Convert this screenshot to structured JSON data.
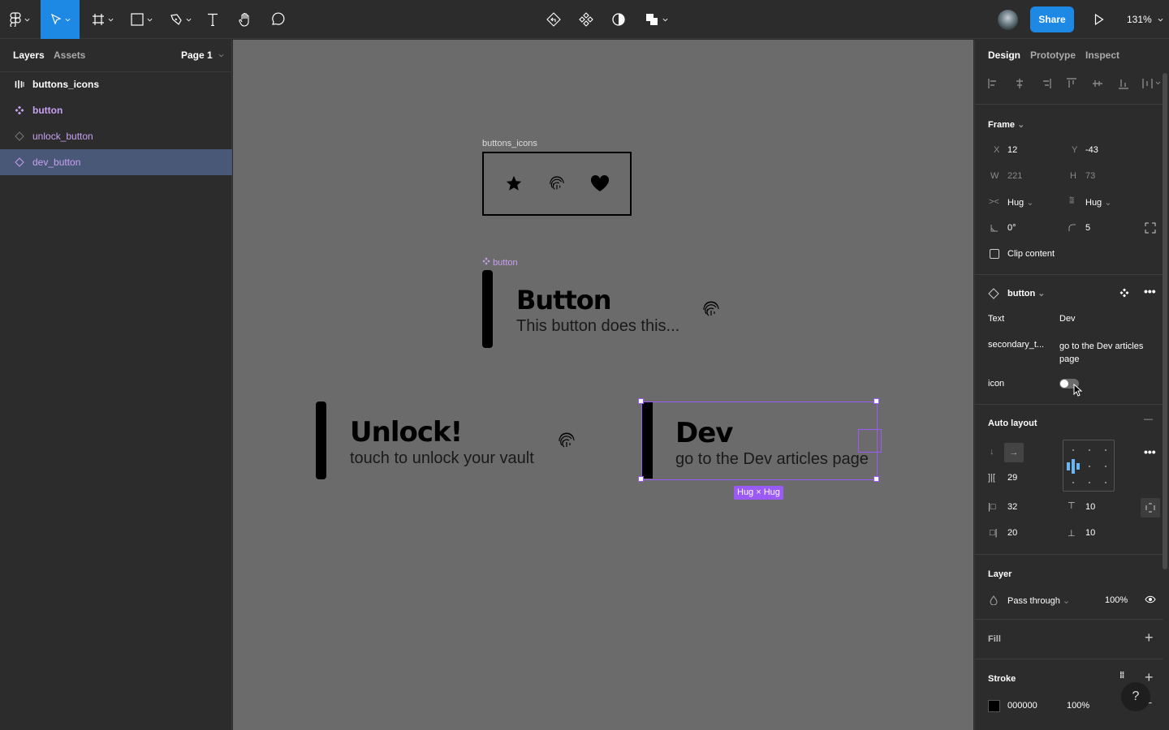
{
  "toolbar": {
    "zoom": "131%",
    "share_label": "Share",
    "tools": [
      "main-menu",
      "move",
      "frame",
      "shape",
      "pen",
      "text",
      "hand",
      "comment"
    ],
    "center_tools": [
      "back-to-instance",
      "components",
      "theme",
      "boolean"
    ]
  },
  "left_panel": {
    "tabs": [
      "Layers",
      "Assets"
    ],
    "page": "Page 1",
    "layers": [
      {
        "name": "buttons_icons",
        "icon": "auto-layout-icon",
        "color": "#ffffff"
      },
      {
        "name": "button",
        "icon": "component-icon",
        "color": "#c7a0f0"
      },
      {
        "name": "unlock_button",
        "icon": "instance-icon",
        "color": "#c7a0f0"
      },
      {
        "name": "dev_button",
        "icon": "instance-icon",
        "color": "#c7a0f0",
        "selected": true
      }
    ]
  },
  "canvas": {
    "icons_frame_label": "buttons_icons",
    "component_label": "button",
    "button_component": {
      "title": "Button",
      "subtitle": "This button does this..."
    },
    "unlock_button": {
      "title": "Unlock!",
      "subtitle": "touch to unlock your vault"
    },
    "dev_button": {
      "title": "Dev",
      "subtitle": "go to the Dev articles page"
    },
    "size_badge": "Hug × Hug"
  },
  "right_panel": {
    "tabs": [
      "Design",
      "Prototype",
      "Inspect"
    ],
    "frame": {
      "title": "Frame",
      "x_label": "X",
      "x": "12",
      "y_label": "Y",
      "y": "-43",
      "w_label": "W",
      "w": "221",
      "h_label": "H",
      "h": "73",
      "hsize": "Hug",
      "vsize": "Hug",
      "rotation": "0°",
      "radius": "5",
      "clip_label": "Clip content"
    },
    "instance": {
      "component": "button",
      "props": [
        {
          "label": "Text",
          "value": "Dev"
        },
        {
          "label": "secondary_t...",
          "value": "go to the Dev articles page"
        },
        {
          "label": "icon",
          "value": "off"
        }
      ]
    },
    "auto_layout": {
      "title": "Auto layout",
      "spacing": "29",
      "pad_left": "32",
      "pad_top": "10",
      "pad_right": "20",
      "pad_bottom": "10"
    },
    "layer": {
      "title": "Layer",
      "blend": "Pass through",
      "opacity": "100%"
    },
    "fill": {
      "title": "Fill"
    },
    "stroke": {
      "title": "Stroke",
      "color": "000000",
      "opacity": "100%",
      "swatch": "#000000"
    }
  }
}
